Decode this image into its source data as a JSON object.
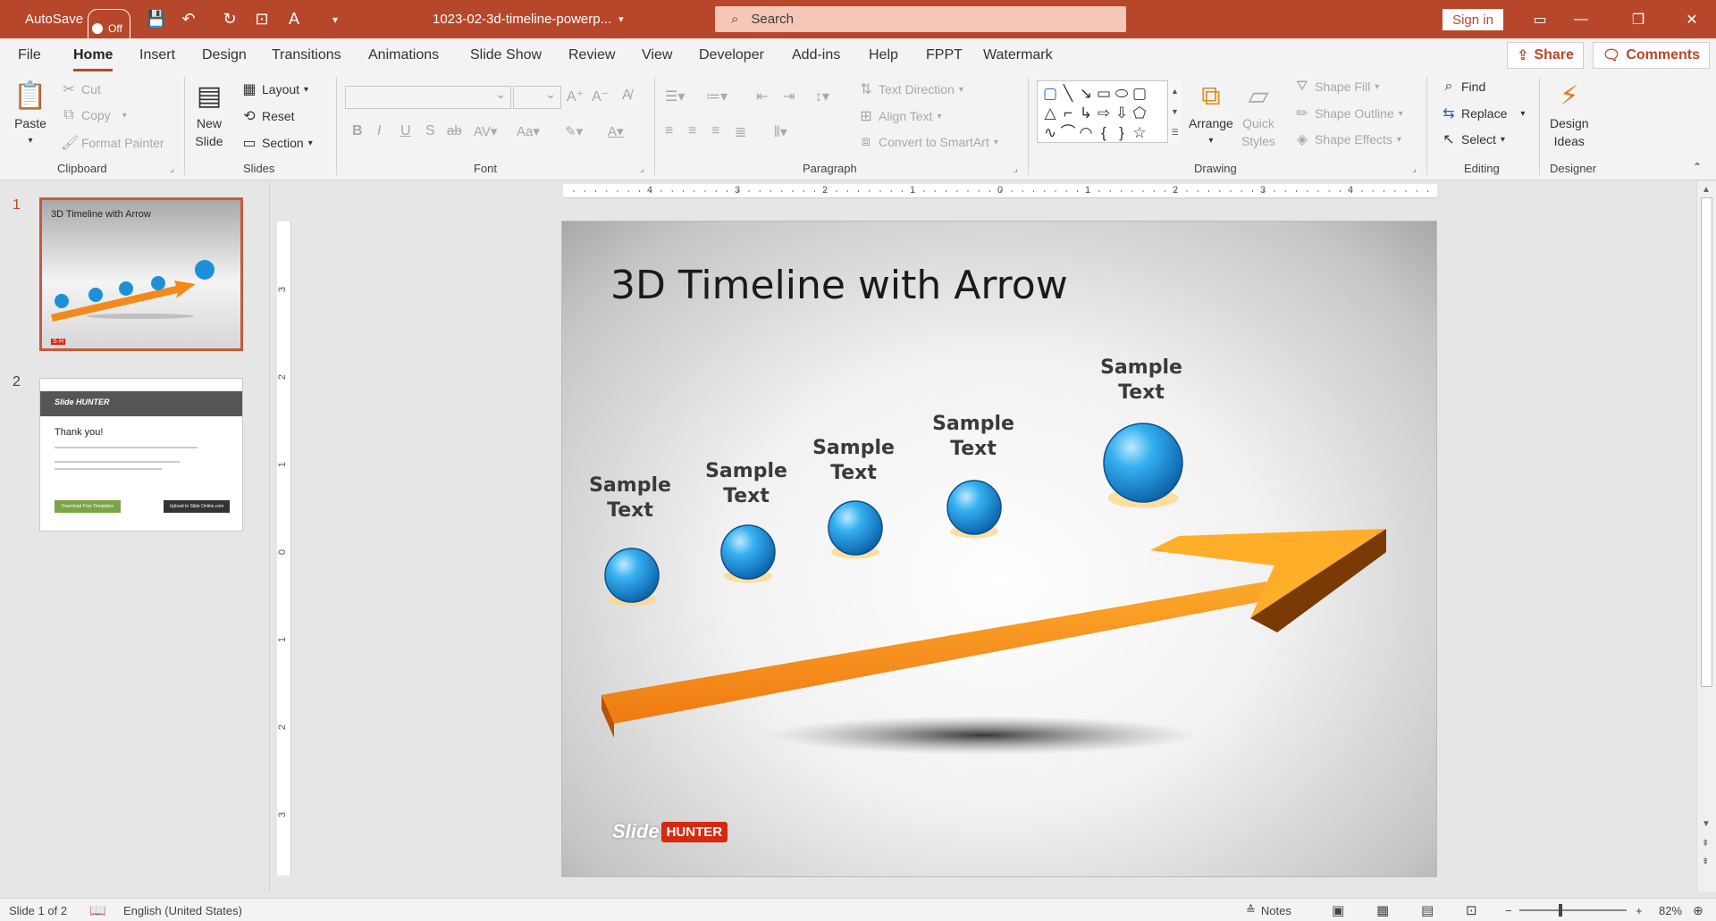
{
  "titlebar": {
    "autosave_label": "AutoSave",
    "autosave_state": "Off",
    "doc_title": "1023-02-3d-timeline-powerp...",
    "search_placeholder": "Search",
    "signin_label": "Sign in",
    "bg_color": "#b7472a"
  },
  "tabs": [
    "File",
    "Home",
    "Insert",
    "Design",
    "Transitions",
    "Animations",
    "Slide Show",
    "Review",
    "View",
    "Developer",
    "Add-ins",
    "Help",
    "FPPT",
    "Watermark"
  ],
  "active_tab": "Home",
  "share_label": "Share",
  "comments_label": "Comments",
  "ribbon": {
    "clipboard": {
      "label": "Clipboard",
      "paste": "Paste",
      "cut": "Cut",
      "copy": "Copy",
      "format_painter": "Format Painter"
    },
    "slides": {
      "label": "Slides",
      "new_slide_1": "New",
      "new_slide_2": "Slide",
      "layout": "Layout",
      "reset": "Reset",
      "section": "Section"
    },
    "font": {
      "label": "Font"
    },
    "paragraph": {
      "label": "Paragraph",
      "text_direction": "Text Direction",
      "align_text": "Align Text",
      "convert_smartart": "Convert to SmartArt"
    },
    "drawing": {
      "label": "Drawing",
      "arrange": "Arrange",
      "quick_styles_1": "Quick",
      "quick_styles_2": "Styles",
      "shape_fill": "Shape Fill",
      "shape_outline": "Shape Outline",
      "shape_effects": "Shape Effects"
    },
    "editing": {
      "label": "Editing",
      "find": "Find",
      "replace": "Replace",
      "select": "Select"
    },
    "designer": {
      "label": "Designer",
      "design_ideas_1": "Design",
      "design_ideas_2": "Ideas"
    }
  },
  "thumbnails": [
    {
      "num": "1",
      "title": "3D Timeline with Arrow"
    },
    {
      "num": "2",
      "title": "Thank you!",
      "header_brand": "Slide HUNTER",
      "btn_left": "Download Free Templates",
      "btn_right": "Upload to Slide Online.com"
    }
  ],
  "slide": {
    "title": "3D Timeline with Arrow",
    "milestones": [
      {
        "line1": "Sample",
        "line2": "Text"
      },
      {
        "line1": "Sample",
        "line2": "Text"
      },
      {
        "line1": "Sample",
        "line2": "Text"
      },
      {
        "line1": "Sample",
        "line2": "Text"
      },
      {
        "line1": "Sample",
        "line2": "Text"
      }
    ],
    "brand_slide": "Slide",
    "brand_hunter": "HUNTER",
    "arrow_color": "#f28a1a",
    "sphere_color": "#1e90d8"
  },
  "status": {
    "slide_info": "Slide 1 of 2",
    "language": "English (United States)",
    "notes": "Notes",
    "zoom": "82%"
  }
}
